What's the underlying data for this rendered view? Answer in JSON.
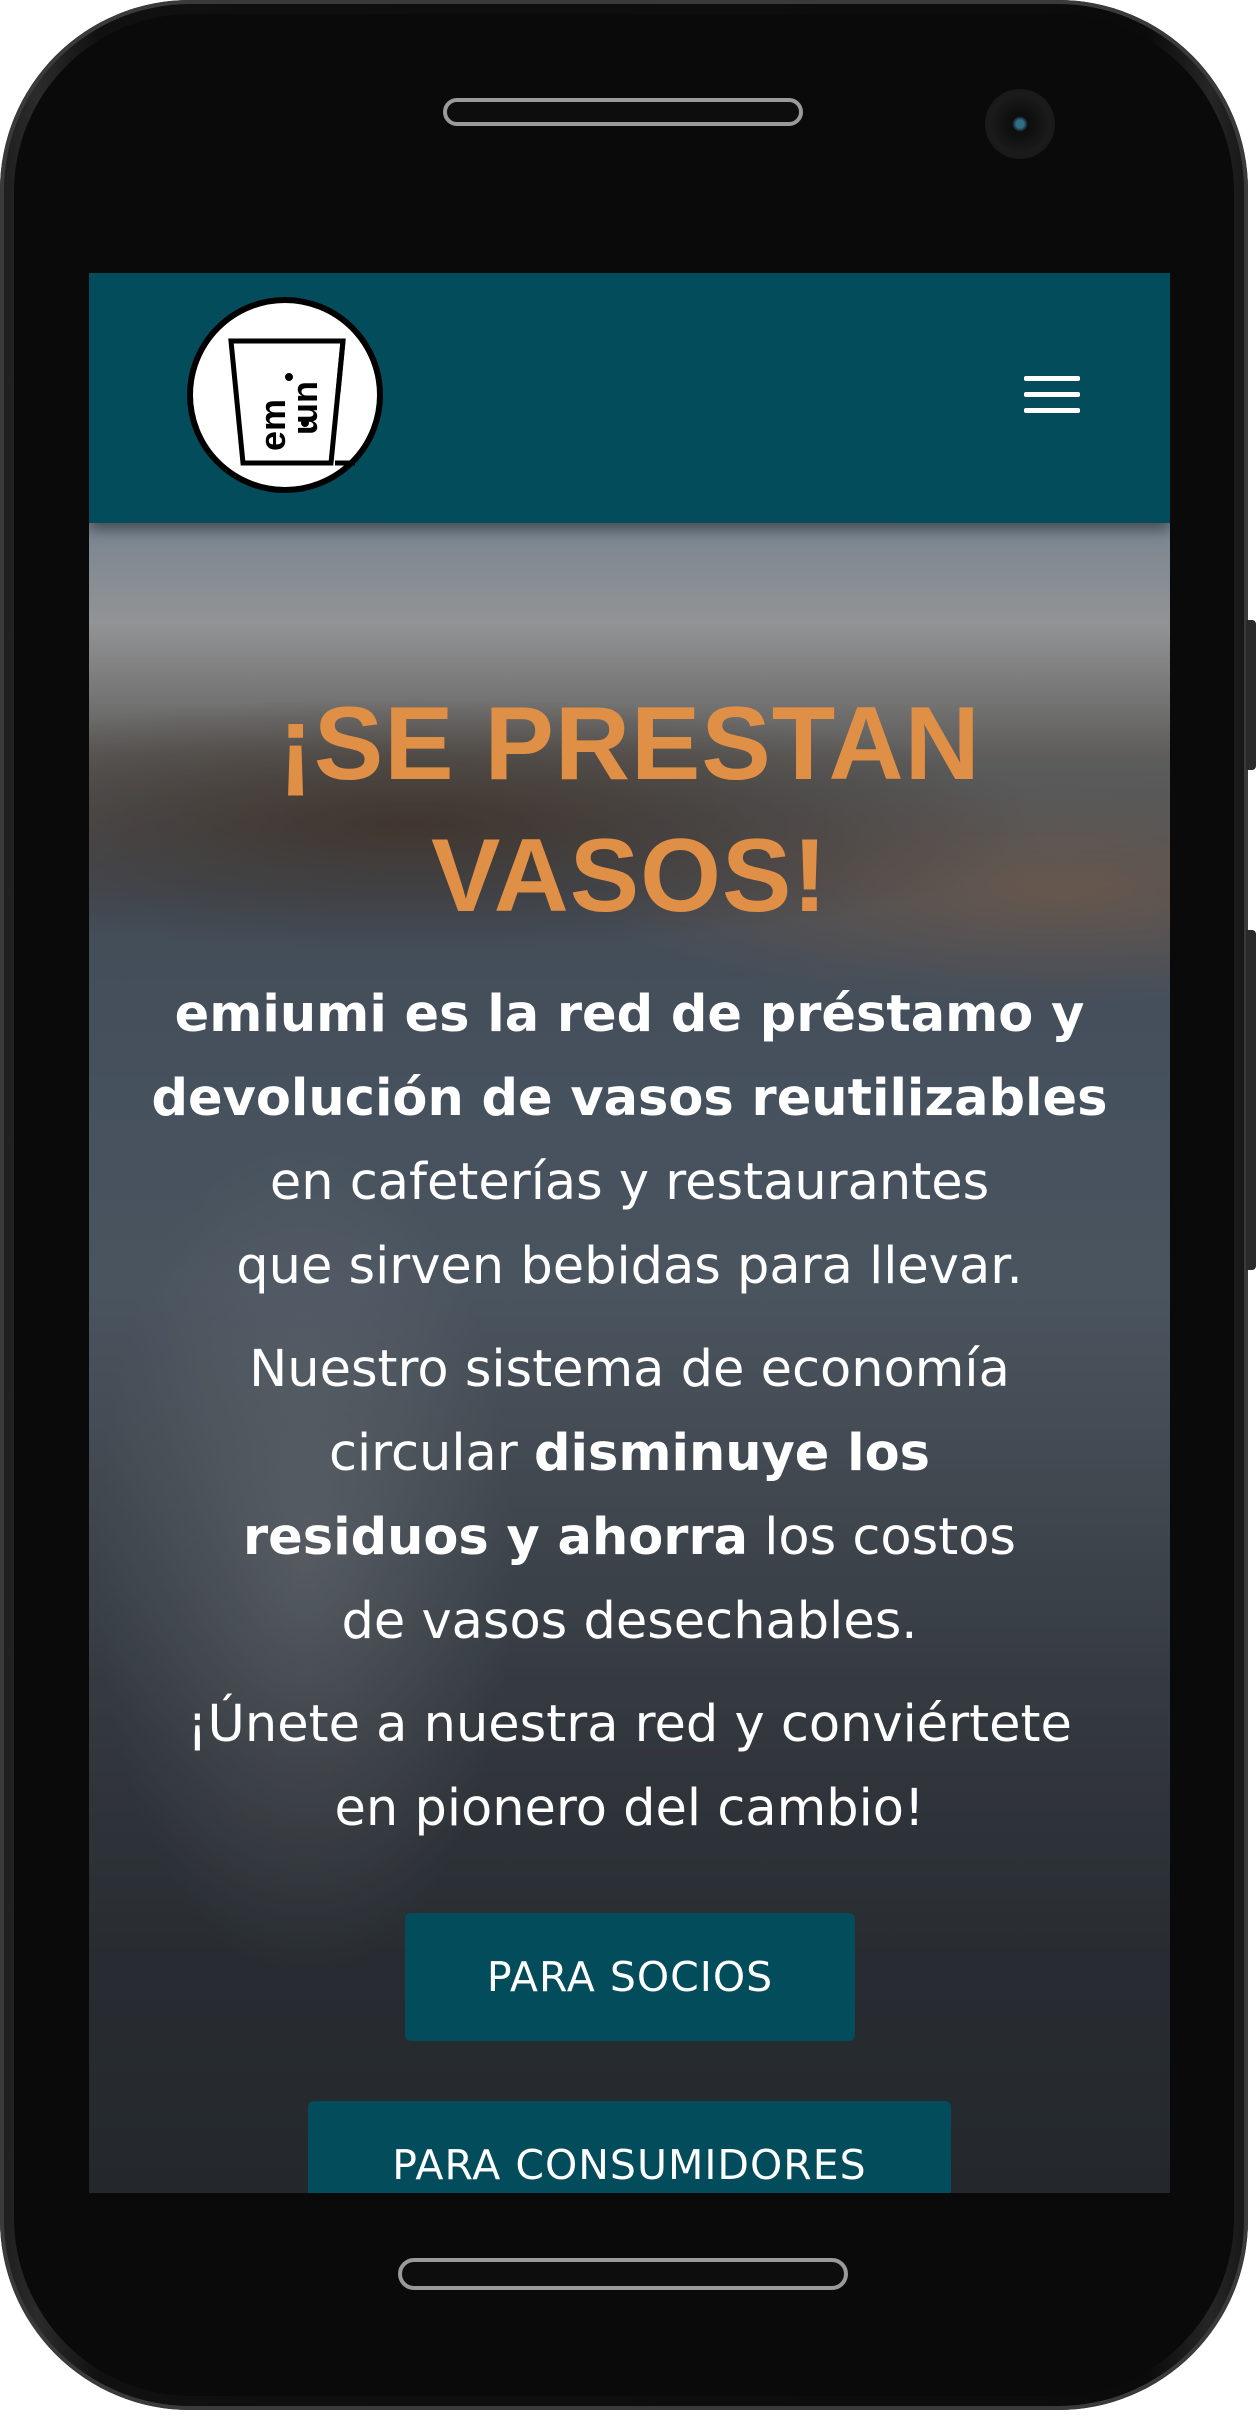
{
  "header": {
    "logo_text": "emiumi",
    "menu_icon": "hamburger-menu-icon"
  },
  "hero": {
    "title_line1": "¡SE PRESTAN",
    "title_line2": "VASOS!",
    "p1": {
      "bold_line1": "emiumi es la red de préstamo y",
      "bold_line2": "devolución de vasos reutilizables",
      "line3": "en cafeterías y restaurantes",
      "line4": "que sirven bebidas para llevar."
    },
    "p2": {
      "line1": "Nuestro sistema de economía",
      "line2_normal": "circular ",
      "line2_bold": "disminuye los",
      "line3_bold": "residuos y ahorra",
      "line3_normal": " los costos",
      "line4": "de vasos desechables."
    },
    "p3": {
      "line1": "¡Únete a nuestra red y conviértete",
      "line2": "en pionero del cambio!"
    },
    "buttons": {
      "socios": "PARA SOCIOS",
      "consumidores": "PARA CONSUMIDORES"
    }
  },
  "colors": {
    "header_bg": "#034c5b",
    "title": "#e08f46",
    "button_bg": "#034c5b",
    "text": "#ffffff"
  }
}
